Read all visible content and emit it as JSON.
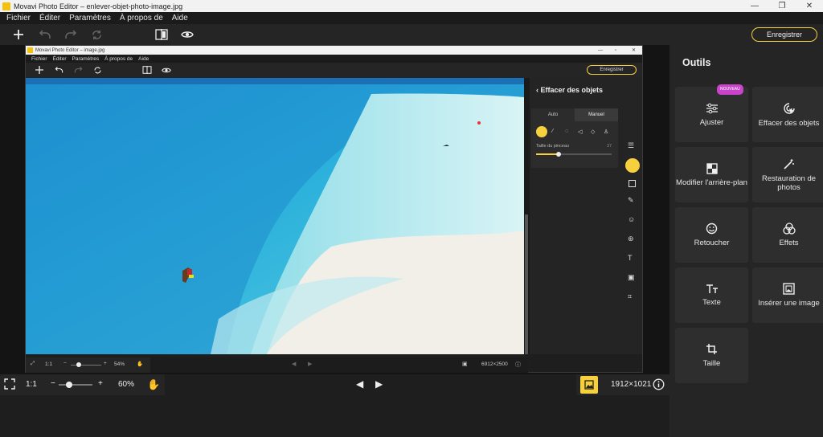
{
  "window": {
    "title": "Movavi Photo Editor – enlever-objet-photo-image.jpg"
  },
  "menu": [
    "Fichier",
    "Éditer",
    "Paramètres",
    "À propos de",
    "Aide"
  ],
  "toolbar": {
    "save_label": "Enregistrer"
  },
  "inner": {
    "title": "Movavi Photo Editor – image.jpg",
    "menu": [
      "Fichier",
      "Éditer",
      "Paramètres",
      "À propos de",
      "Aide"
    ],
    "save_label": "Enregistrer",
    "panel": {
      "back_title": "Effacer des objets",
      "tabs": [
        "Auto",
        "Manuel"
      ],
      "active_tab": "Manuel",
      "brush_label": "Taille du pinceau",
      "brush_value": "37",
      "brush_fraction": 0.3
    },
    "bottom": {
      "ratio": "1:1",
      "zoom": "54%",
      "zoom_fraction": 0.25,
      "dimensions": "6912×2500"
    }
  },
  "right_panel": {
    "title": "Outils",
    "tools": [
      {
        "label": "Ajuster",
        "badge": "NOUVEAU",
        "icon": "sliders-icon"
      },
      {
        "label": "Effacer des objets",
        "icon": "eraser-target-icon"
      },
      {
        "label": "Modifier l'arrière-plan",
        "icon": "background-icon"
      },
      {
        "label": "Restauration de photos",
        "icon": "magic-wand-icon"
      },
      {
        "label": "Retoucher",
        "icon": "smile-icon"
      },
      {
        "label": "Effets",
        "icon": "effects-icon"
      },
      {
        "label": "Texte",
        "icon": "text-icon"
      },
      {
        "label": "Insérer une image",
        "icon": "insert-image-icon"
      },
      {
        "label": "Taille",
        "icon": "crop-icon"
      }
    ]
  },
  "bottom": {
    "ratio": "1:1",
    "zoom": "60%",
    "zoom_fraction": 0.3,
    "dimensions": "1912×1021"
  },
  "colors": {
    "accent": "#f6d13d",
    "badge": "#c944c9",
    "panel": "#252525",
    "card": "#2e2e2e"
  }
}
